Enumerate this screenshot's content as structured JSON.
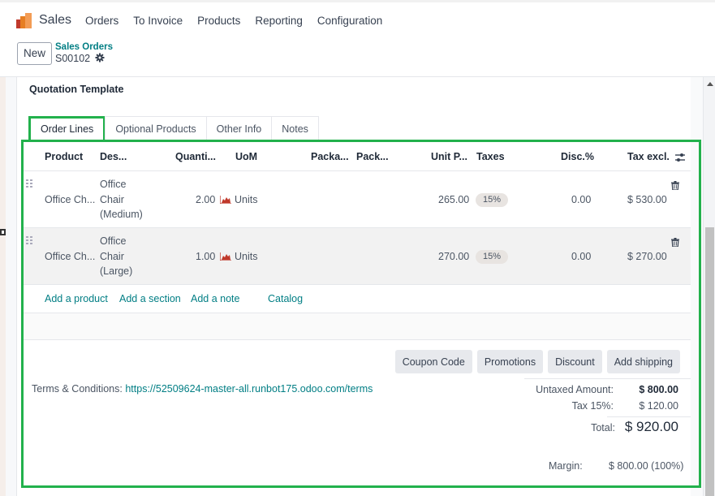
{
  "app": {
    "name": "Sales",
    "nav": [
      "Orders",
      "To Invoice",
      "Products",
      "Reporting",
      "Configuration"
    ]
  },
  "control_panel": {
    "new_label": "New",
    "breadcrumb_parent": "Sales Orders",
    "record_name": "S00102"
  },
  "form": {
    "section_title": "Quotation Template",
    "tabs": [
      {
        "label": "Order Lines",
        "active": true
      },
      {
        "label": "Optional Products",
        "active": false
      },
      {
        "label": "Other Info",
        "active": false
      },
      {
        "label": "Notes",
        "active": false
      }
    ],
    "columns": {
      "product": "Product",
      "description": "Des...",
      "quantity": "Quanti...",
      "uom": "UoM",
      "packaging_qty": "Packa...",
      "packaging": "Pack...",
      "unit_price": "Unit P...",
      "taxes": "Taxes",
      "discount": "Disc.%",
      "subtotal": "Tax excl."
    },
    "lines": [
      {
        "product": "Office Ch...",
        "description": [
          "Office",
          "Chair",
          "(Medium)"
        ],
        "quantity": "2.00",
        "uom": "Units",
        "unit_price": "265.00",
        "tax": "15%",
        "discount": "0.00",
        "subtotal": "$ 530.00"
      },
      {
        "product": "Office Ch...",
        "description": [
          "Office",
          "Chair",
          "(Large)"
        ],
        "quantity": "1.00",
        "uom": "Units",
        "unit_price": "270.00",
        "tax": "15%",
        "discount": "0.00",
        "subtotal": "$ 270.00"
      }
    ],
    "add_links": {
      "add_product": "Add a product",
      "add_section": "Add a section",
      "add_note": "Add a note",
      "catalog": "Catalog"
    },
    "action_buttons": [
      "Coupon Code",
      "Promotions",
      "Discount",
      "Add shipping"
    ],
    "terms_label": "Terms & Conditions:",
    "terms_url": "https://52509624-master-all.runbot175.odoo.com/terms",
    "totals": {
      "untaxed_label": "Untaxed Amount:",
      "untaxed_value": "$ 800.00",
      "tax_label": "Tax 15%:",
      "tax_value": "$ 120.00",
      "total_label": "Total:",
      "total_value": "$ 920.00",
      "margin_label": "Margin:",
      "margin_value": "$ 800.00 (100%)"
    }
  },
  "colors": {
    "accent": "#017e84",
    "highlight": "#22b14c"
  }
}
